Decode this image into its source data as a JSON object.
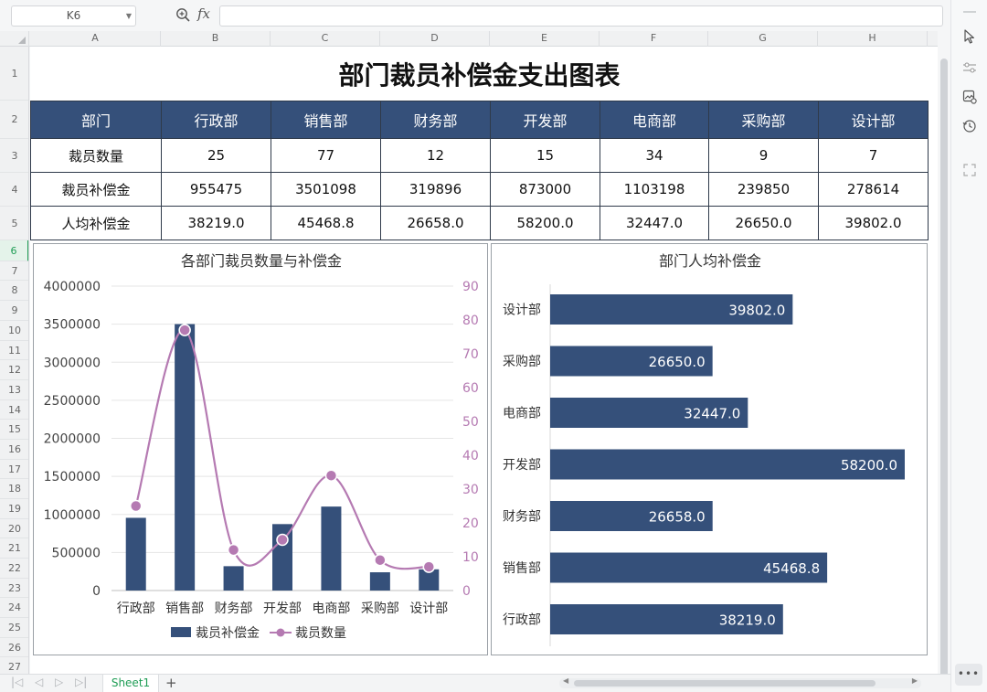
{
  "formula_bar": {
    "cell_ref": "K6",
    "fx_label": "fx",
    "formula": ""
  },
  "columns": [
    "A",
    "B",
    "C",
    "D",
    "E",
    "F",
    "G",
    "H"
  ],
  "rows": [
    "1",
    "2",
    "3",
    "4",
    "5",
    "6",
    "7",
    "8",
    "9",
    "10",
    "11",
    "12",
    "13",
    "14",
    "15",
    "16",
    "17",
    "18",
    "19",
    "20",
    "21",
    "22",
    "23",
    "24",
    "25",
    "26",
    "27"
  ],
  "active_row": "6",
  "sheet": {
    "title": "部门裁员补偿金支出图表",
    "table": {
      "header": [
        "部门",
        "行政部",
        "销售部",
        "财务部",
        "开发部",
        "电商部",
        "采购部",
        "设计部"
      ],
      "rows": [
        [
          "裁员数量",
          "25",
          "77",
          "12",
          "15",
          "34",
          "9",
          "7"
        ],
        [
          "裁员补偿金",
          "955475",
          "3501098",
          "319896",
          "873000",
          "1103198",
          "239850",
          "278614"
        ],
        [
          "人均补偿金",
          "38219.0",
          "45468.8",
          "26658.0",
          "58200.0",
          "32447.0",
          "26650.0",
          "39802.0"
        ]
      ]
    }
  },
  "chart_data": [
    {
      "type": "bar",
      "title": "各部门裁员数量与补偿金",
      "categories": [
        "行政部",
        "销售部",
        "财务部",
        "开发部",
        "电商部",
        "采购部",
        "设计部"
      ],
      "series": [
        {
          "name": "裁员补偿金",
          "type": "bar",
          "axis": "left",
          "color": "#35507a",
          "values": [
            955475,
            3501098,
            319896,
            873000,
            1103198,
            239850,
            278614
          ]
        },
        {
          "name": "裁员数量",
          "type": "line",
          "axis": "right",
          "smooth": true,
          "color": "#b57ab2",
          "values": [
            25,
            77,
            12,
            15,
            34,
            9,
            7
          ]
        }
      ],
      "ylim": [
        0,
        4000000
      ],
      "y_ticks": [
        "4000000",
        "3500000",
        "3000000",
        "2500000",
        "2000000",
        "1500000",
        "1000000",
        "500000",
        "0"
      ],
      "y2lim": [
        0,
        90
      ],
      "y2_ticks": [
        "90",
        "80",
        "70",
        "60",
        "50",
        "40",
        "30",
        "20",
        "10",
        "0"
      ],
      "grid": true,
      "legend": "bottom"
    },
    {
      "type": "bar",
      "orientation": "horizontal",
      "title": "部门人均补偿金",
      "categories": [
        "设计部",
        "采购部",
        "电商部",
        "开发部",
        "财务部",
        "销售部",
        "行政部"
      ],
      "values": [
        39802.0,
        26650.0,
        32447.0,
        58200.0,
        26658.0,
        45468.8,
        38219.0
      ],
      "labels": [
        "39802.0",
        "26650.0",
        "32447.0",
        "58200.0",
        "26658.0",
        "45468.8",
        "38219.0"
      ],
      "color": "#35507a",
      "data_labels": "inside-end",
      "grid": false
    }
  ],
  "sheet_tabs": {
    "active": "Sheet1",
    "add": "+"
  },
  "right_toolbar": [
    "cursor-icon",
    "sliders-icon",
    "image-settings-icon",
    "history-icon",
    "frame-icon"
  ],
  "more_label": "•••"
}
